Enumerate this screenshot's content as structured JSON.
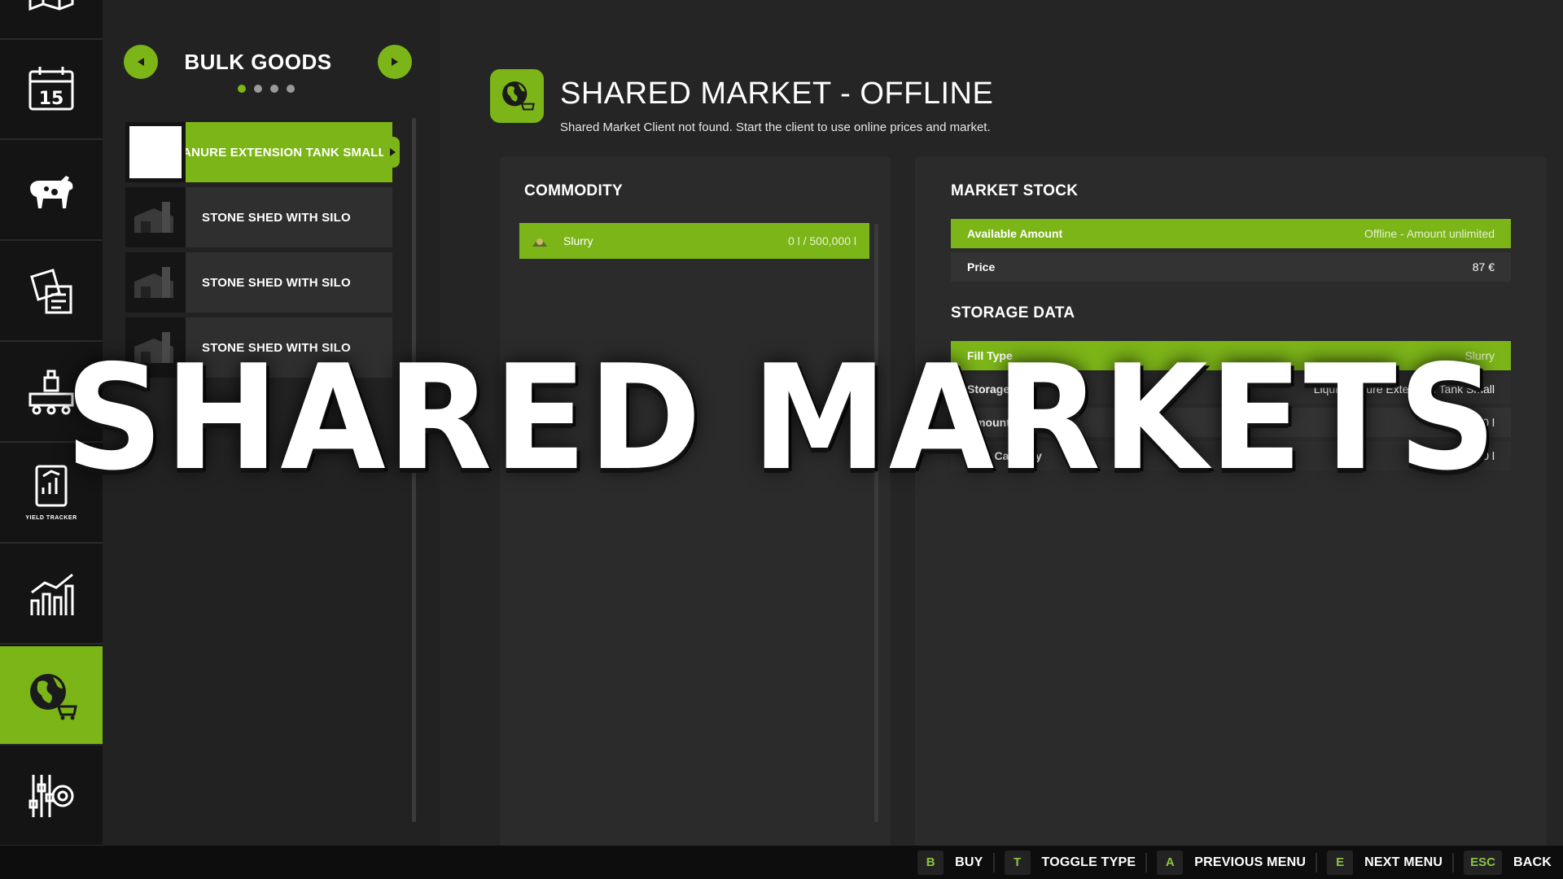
{
  "nav": {
    "rail_items": [
      {
        "name": "map-icon"
      },
      {
        "name": "calendar-icon",
        "day": "15"
      },
      {
        "name": "animals-icon"
      },
      {
        "name": "contracts-icon"
      },
      {
        "name": "production-icon"
      },
      {
        "name": "yield-tracker-icon",
        "caption": "YIELD TRACKER"
      },
      {
        "name": "statistics-icon"
      },
      {
        "name": "shared-market-icon",
        "active": true
      },
      {
        "name": "settings-icon"
      }
    ]
  },
  "category": {
    "title": "BULK GOODS",
    "page_count": 4,
    "current_page": 1,
    "items": [
      {
        "label": "LIQUIDMANURE EXTENSION TANK SMALL",
        "selected": true
      },
      {
        "label": "STONE SHED WITH SILO",
        "selected": false
      },
      {
        "label": "STONE SHED WITH SILO",
        "selected": false
      },
      {
        "label": "STONE SHED WITH SILO",
        "selected": false
      }
    ]
  },
  "header": {
    "title": "SHARED MARKET - OFFLINE",
    "subtitle": "Shared Market Client not found. Start the client to use online prices and market."
  },
  "commodity": {
    "title": "COMMODITY",
    "row": {
      "name": "Slurry",
      "value": "0 l / 500,000 l"
    }
  },
  "market_stock": {
    "title": "MARKET STOCK",
    "rows": [
      {
        "key": "Available Amount",
        "value": "Offline - Amount unlimited"
      },
      {
        "key": "Price",
        "value": "87 €"
      }
    ]
  },
  "storage_data": {
    "title": "STORAGE DATA",
    "rows": [
      {
        "key": "Fill Type",
        "value": "Slurry"
      },
      {
        "key": "Storage",
        "value": "Liquidmanure Extension Tank Small"
      },
      {
        "key": "Amount",
        "value": "0 l"
      },
      {
        "key": "Free Capacity",
        "value": "500,000 l"
      }
    ]
  },
  "overlay": {
    "text": "SHARED MARKETS"
  },
  "actions": [
    {
      "key": "B",
      "label": "BUY"
    },
    {
      "key": "T",
      "label": "TOGGLE TYPE"
    },
    {
      "key": "A",
      "label": "PREVIOUS MENU"
    },
    {
      "key": "E",
      "label": "NEXT MENU"
    },
    {
      "key": "ESC",
      "label": "BACK"
    }
  ],
  "colors": {
    "accent": "#7cb518",
    "background": "#262626",
    "rail": "#141414"
  }
}
